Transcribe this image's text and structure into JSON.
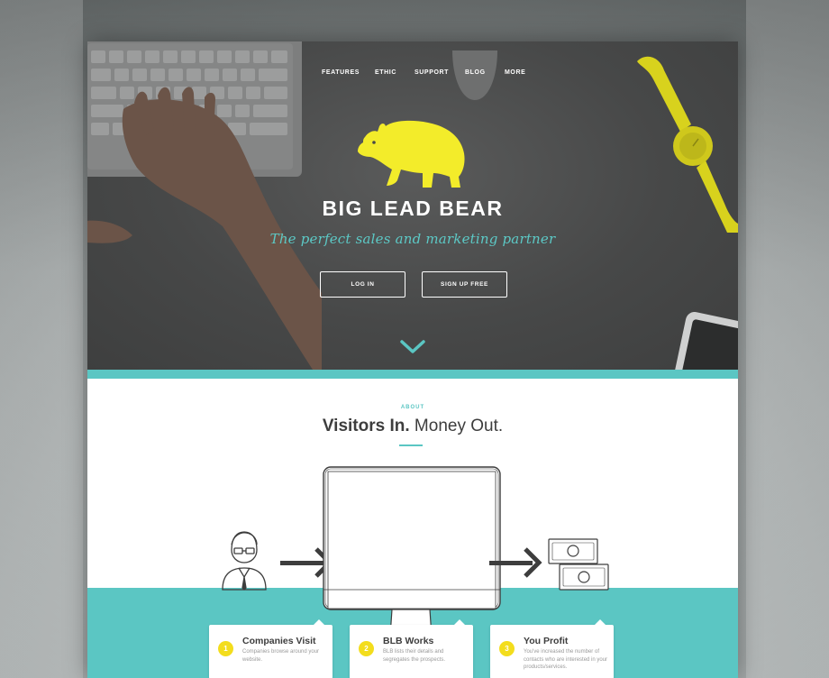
{
  "nav": {
    "items": [
      {
        "label": "FEATURES"
      },
      {
        "label": "ETHIC"
      },
      {
        "label": "SUPPORT"
      },
      {
        "label": "BLOG"
      },
      {
        "label": "MORE"
      }
    ]
  },
  "hero": {
    "brand": "BIG LEAD BEAR",
    "tagline": "The perfect sales and marketing partner",
    "login_label": "LOG IN",
    "signup_label": "SIGN UP FREE",
    "logo_icon": "bear-logo-icon",
    "scroll_icon": "chevron-down-icon"
  },
  "about": {
    "label": "ABOUT",
    "title_bold": "Visitors In.",
    "title_rest": " Money Out."
  },
  "steps": [
    {
      "number": "1",
      "title": "Companies Visit",
      "text": "Companies browse around your website."
    },
    {
      "number": "2",
      "title": "BLB Works",
      "text": "BLB lists their details and segregates the prospects."
    },
    {
      "number": "3",
      "title": "You Profit",
      "text": "You've increased the number of contacts who are interested in your products/services."
    }
  ],
  "colors": {
    "accent": "#5bc6c3",
    "brand_yellow": "#f3ec2a",
    "step_yellow": "#f3dd1d",
    "hero_dark": "#474848"
  }
}
